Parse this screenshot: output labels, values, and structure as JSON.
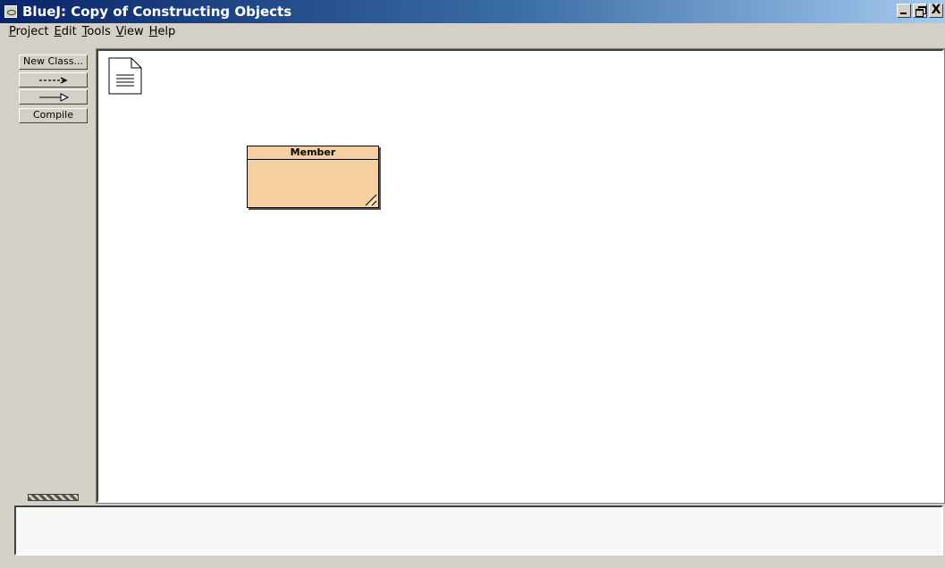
{
  "window": {
    "title": "BlueJ:  Copy of Constructing Objects",
    "icon": "bluej-app-icon",
    "controls": {
      "minimize": "_",
      "close": "X"
    }
  },
  "menubar": {
    "items": [
      "Project",
      "Edit",
      "Tools",
      "View",
      "Help"
    ]
  },
  "toolbar": {
    "new_class_label": "New Class...",
    "uses_arrow_label": "--->",
    "compile_label": "Compile"
  },
  "diagram": {
    "readme_icon": "document-icon",
    "classes": [
      {
        "name": "Member",
        "fill_color": "#f5cfa0"
      }
    ]
  },
  "message_area": {
    "text": ""
  }
}
